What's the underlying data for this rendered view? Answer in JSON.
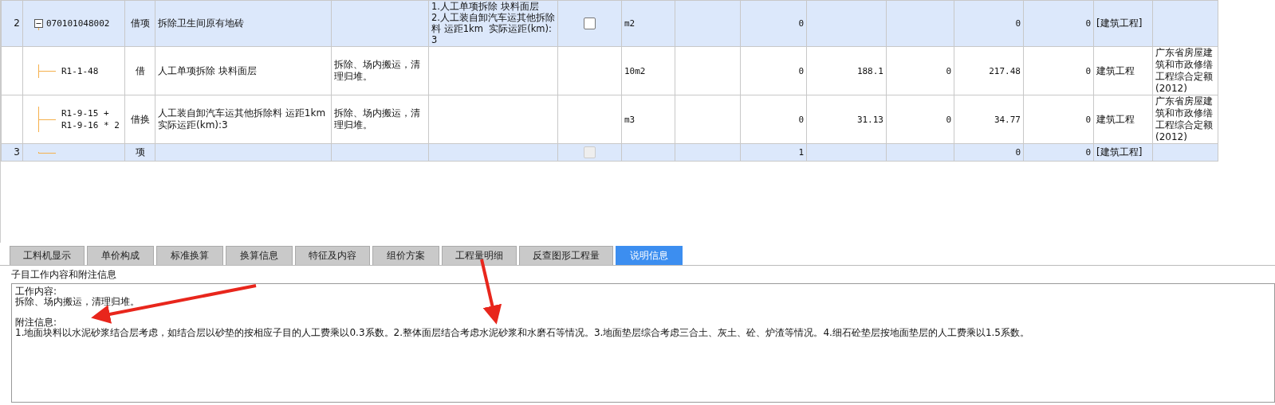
{
  "table": {
    "rows": [
      {
        "kind": "item",
        "num": "2",
        "code": "070101048002",
        "expanded": true,
        "type": "借项",
        "name": "拆除卫生间原有地砖",
        "content": "",
        "features": "1.人工单项拆除 块料面层\n2.人工装自卸汽车运其他拆除料 运距1km  实际运距(km):3",
        "checkbox": {
          "checked": false,
          "disabled": false
        },
        "unit": "m2",
        "qty": "0",
        "price": "",
        "c11": "",
        "total": "0",
        "c13": "0",
        "category": "[建筑工程]",
        "source": ""
      },
      {
        "kind": "sub",
        "num": "",
        "code": "R1-1-48",
        "type": "借",
        "name": "人工单项拆除 块料面层",
        "content": "拆除、场内搬运，清理归堆。",
        "features": "",
        "unit": "10m2",
        "qty": "0",
        "price": "188.1",
        "c11": "0",
        "total": "217.48",
        "c13": "0",
        "category": "建筑工程",
        "source": "广东省房屋建筑和市政修缮工程综合定额(2012)"
      },
      {
        "kind": "sub",
        "num": "",
        "code": "R1-9-15 + R1-9-16 * 2",
        "type": "借换",
        "name": "人工装自卸汽车运其他拆除料 运距1km 实际运距(km):3",
        "content": "拆除、场内搬运，清理归堆。",
        "features": "",
        "unit": "m3",
        "qty": "0",
        "price": "31.13",
        "c11": "0",
        "total": "34.77",
        "c13": "0",
        "category": "建筑工程",
        "source": "广东省房屋建筑和市政修缮工程综合定额(2012)"
      },
      {
        "kind": "item",
        "num": "3",
        "code": "",
        "type": "项",
        "name": "",
        "content": "",
        "features": "",
        "checkbox": {
          "checked": false,
          "disabled": true
        },
        "unit": "",
        "qty": "1",
        "price": "",
        "c11": "",
        "total": "0",
        "c13": "0",
        "category": "[建筑工程]",
        "source": ""
      }
    ]
  },
  "tabs": [
    {
      "label": "工料机显示",
      "selected": false
    },
    {
      "label": "单价构成",
      "selected": false
    },
    {
      "label": "标准换算",
      "selected": false
    },
    {
      "label": "换算信息",
      "selected": false
    },
    {
      "label": "特征及内容",
      "selected": false
    },
    {
      "label": "组价方案",
      "selected": false
    },
    {
      "label": "工程量明细",
      "selected": false
    },
    {
      "label": "反查图形工程量",
      "selected": false
    },
    {
      "label": "说明信息",
      "selected": true
    }
  ],
  "panel": {
    "title": "子目工作内容和附注信息",
    "sections": [
      {
        "heading": "工作内容:",
        "text": "拆除、场内搬运，清理归堆。"
      },
      {
        "heading": "附注信息:",
        "text": "1.地面块料以水泥砂浆结合层考虑，如结合层以砂垫的按相应子目的人工费乘以0.3系数。2.整体面层结合考虑水泥砂浆和水磨石等情况。3.地面垫层综合考虑三合土、灰土、砼、炉渣等情况。4.细石砼垫层按地面垫层的人工费乘以1.5系数。"
      }
    ]
  }
}
